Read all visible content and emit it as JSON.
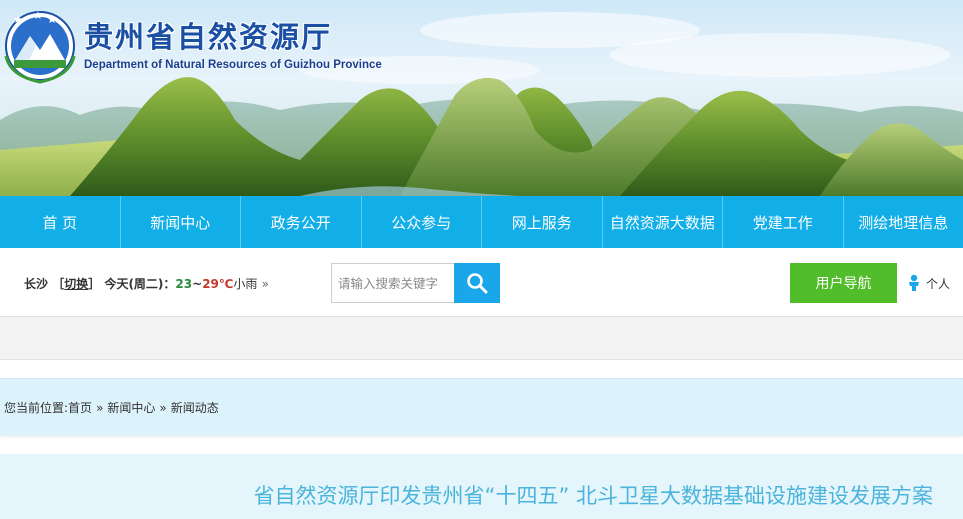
{
  "header": {
    "site_title": "贵州省自然资源厅",
    "site_subtitle": "Department of Natural Resources of Guizhou Province"
  },
  "nav": {
    "items": [
      {
        "label": "首 页"
      },
      {
        "label": "新闻中心"
      },
      {
        "label": "政务公开"
      },
      {
        "label": "公众参与"
      },
      {
        "label": "网上服务"
      },
      {
        "label": "自然资源大数据"
      },
      {
        "label": "党建工作"
      },
      {
        "label": "测绘地理信息"
      }
    ]
  },
  "weather": {
    "city": "长沙",
    "switch_open": "［",
    "switch_label": "切换",
    "switch_close": "］",
    "today": "今天(周二)：",
    "temp_low": "23",
    "range_sep": "~",
    "temp_high": "29",
    "unit": "℃",
    "condition": "小雨",
    "more": "»"
  },
  "search": {
    "placeholder": "请输入搜索关键字",
    "button_icon": "search-icon"
  },
  "toolbar": {
    "guide_label": "用户导航",
    "personal_label": "个人",
    "personal_icon": "person-icon"
  },
  "breadcrumb": {
    "prefix": "您当前位置:",
    "items": [
      {
        "label": "首页"
      },
      {
        "label": "新闻中心"
      },
      {
        "label": "新闻动态"
      }
    ],
    "separator": "»"
  },
  "article": {
    "title": "省自然资源厅印发贵州省“十四五” 北斗卫星大数据基础设施建设发展方案"
  },
  "colors": {
    "nav_bg": "#12aee8",
    "search_btn": "#1aa7ea",
    "guide_btn": "#52bd2a",
    "crumb_bg": "#ddf3fb",
    "title_text": "#4bb4dc"
  }
}
